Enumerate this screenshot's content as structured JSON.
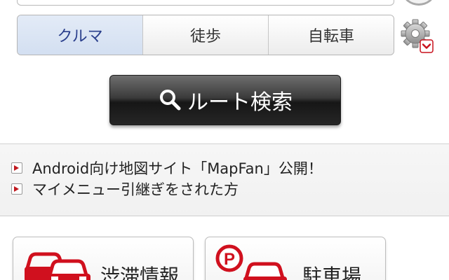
{
  "modes": {
    "items": [
      {
        "label": "クルマ",
        "active": true
      },
      {
        "label": "徒歩",
        "active": false
      },
      {
        "label": "自転車",
        "active": false
      }
    ]
  },
  "route_search": {
    "label": "ルート検索",
    "icon": "search-icon"
  },
  "news": {
    "items": [
      {
        "label": "Android向け地図サイト「MapFan」公開！"
      },
      {
        "label": "マイメニュー引継ぎをされた方"
      }
    ]
  },
  "cards": {
    "traffic": {
      "label": "渋滞情報",
      "icon": "traffic-cars-icon"
    },
    "parking": {
      "label": "駐車場",
      "icon": "parking-icon"
    }
  },
  "colors": {
    "accent_red": "#d0101e",
    "active_mode_text": "#2a3f8c",
    "button_dark": "#262626"
  }
}
